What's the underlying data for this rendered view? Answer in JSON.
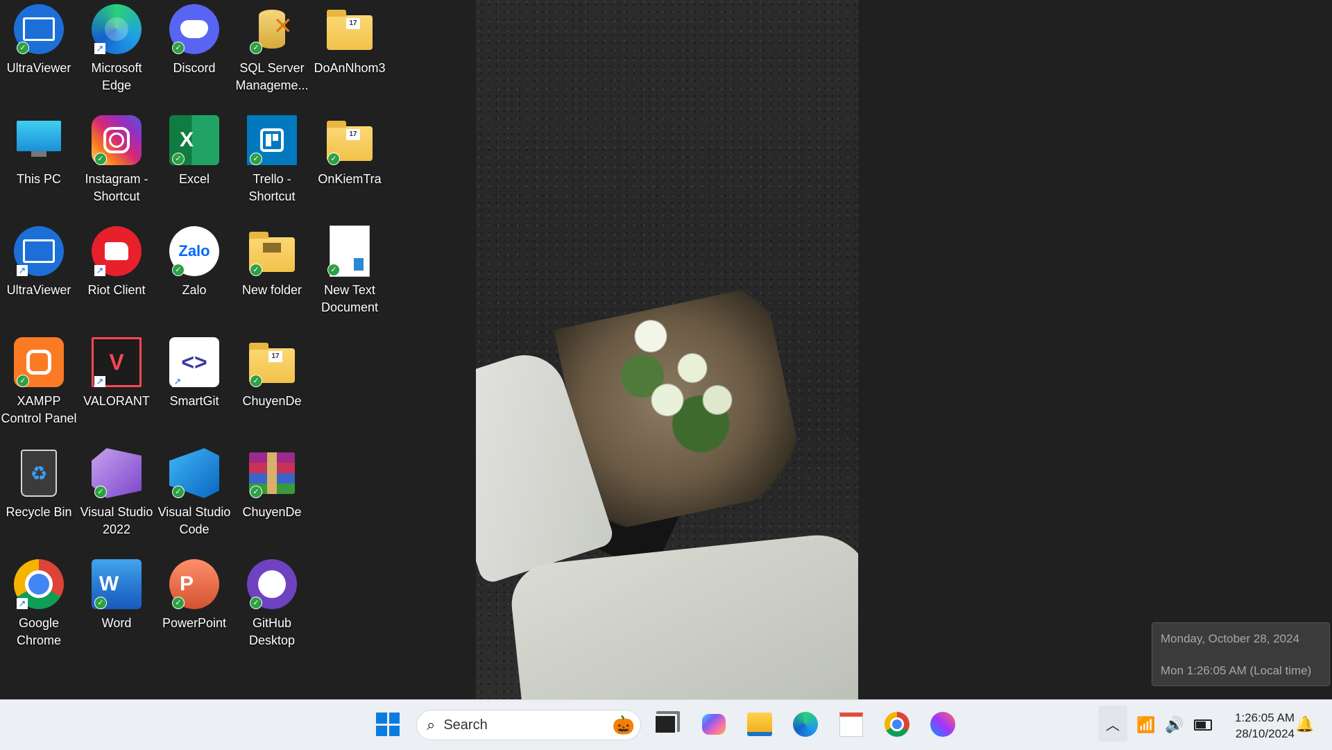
{
  "desktop": {
    "icons": [
      {
        "label": "UltraViewer",
        "icon": "ultraviewer-icon"
      },
      {
        "label": "Microsoft Edge",
        "icon": "edge-icon"
      },
      {
        "label": "Discord",
        "icon": "discord-icon"
      },
      {
        "label": "SQL Server Manageme...",
        "icon": "sql-server-icon"
      },
      {
        "label": "DoAnNhom3",
        "icon": "folder-icon"
      },
      {
        "label": "This PC",
        "icon": "this-pc-icon"
      },
      {
        "label": "Instagram - Shortcut",
        "icon": "instagram-icon"
      },
      {
        "label": "Excel",
        "icon": "excel-icon"
      },
      {
        "label": "Trello - Shortcut",
        "icon": "trello-icon"
      },
      {
        "label": "OnKiemTra",
        "icon": "folder-icon"
      },
      {
        "label": "UltraViewer",
        "icon": "ultraviewer-icon"
      },
      {
        "label": "Riot Client",
        "icon": "riot-client-icon"
      },
      {
        "label": "Zalo",
        "icon": "zalo-icon"
      },
      {
        "label": "New folder",
        "icon": "folder-icon"
      },
      {
        "label": "New Text Document",
        "icon": "text-document-icon"
      },
      {
        "label": "XAMPP Control Panel",
        "icon": "xampp-icon"
      },
      {
        "label": "VALORANT",
        "icon": "valorant-icon"
      },
      {
        "label": "SmartGit",
        "icon": "smartgit-icon"
      },
      {
        "label": "ChuyenDe",
        "icon": "folder-icon"
      },
      {
        "label": "Recycle Bin",
        "icon": "recycle-bin-icon"
      },
      {
        "label": "Visual Studio 2022",
        "icon": "visual-studio-icon"
      },
      {
        "label": "Visual Studio Code",
        "icon": "vscode-icon"
      },
      {
        "label": "ChuyenDe",
        "icon": "winrar-icon"
      },
      {
        "label": "Google Chrome",
        "icon": "chrome-icon"
      },
      {
        "label": "Word",
        "icon": "word-icon"
      },
      {
        "label": "PowerPoint",
        "icon": "powerpoint-icon"
      },
      {
        "label": "GitHub Desktop",
        "icon": "github-desktop-icon"
      }
    ],
    "folder_calendar_day": "17",
    "excel_letter": "X",
    "word_letter": "W",
    "powerpoint_letter": "P",
    "zalo_text": "Zalo"
  },
  "tooltip": {
    "line1": "Monday, October 28, 2024",
    "line2": "Mon 1:26:05 AM (Local time)"
  },
  "taskbar": {
    "search_placeholder": "Search",
    "apps": [
      "start-icon",
      "task-view-icon",
      "copilot-icon",
      "file-explorer-icon",
      "edge-icon",
      "store-icon",
      "chrome-icon",
      "messenger-icon"
    ],
    "clock_time": "1:26:05 AM",
    "clock_date": "28/10/2024"
  }
}
